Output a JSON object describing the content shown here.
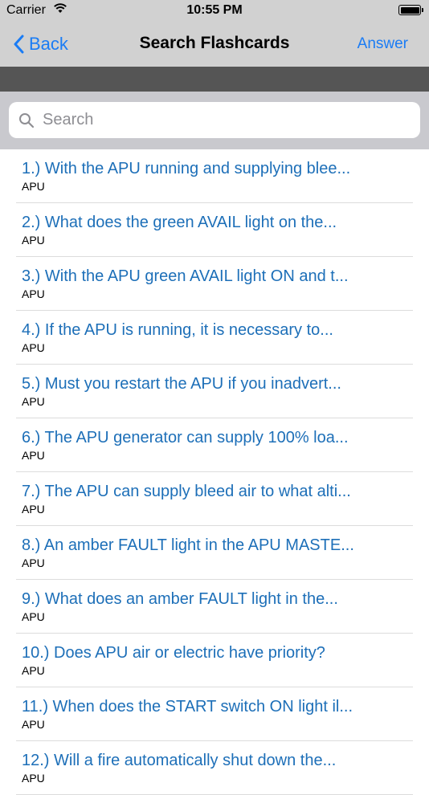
{
  "status_bar": {
    "carrier": "Carrier",
    "time": "10:55 PM"
  },
  "nav": {
    "back_label": "Back",
    "title": "Search Flashcards",
    "answer_label": "Answer"
  },
  "search": {
    "placeholder": "Search",
    "value": ""
  },
  "colors": {
    "accent": "#1a7cf5",
    "item_text": "#1d6fb8",
    "bar_bg": "#d1d1d1",
    "strip_bg": "#555555"
  },
  "items": [
    {
      "question": "1.) With the APU running and supplying blee...",
      "category": "APU"
    },
    {
      "question": "2.) What does the green AVAIL light on the...",
      "category": "APU"
    },
    {
      "question": "3.) With the APU green AVAIL light ON and t...",
      "category": "APU"
    },
    {
      "question": "4.) If the APU is running, it is necessary to...",
      "category": "APU"
    },
    {
      "question": "5.) Must you restart the APU if you inadvert...",
      "category": "APU"
    },
    {
      "question": "6.) The APU generator can supply 100% loa...",
      "category": "APU"
    },
    {
      "question": "7.) The APU can supply bleed air to what alti...",
      "category": "APU"
    },
    {
      "question": "8.) An amber FAULT light in the APU MASTE...",
      "category": "APU"
    },
    {
      "question": "9.) What does an amber FAULT light in the...",
      "category": "APU"
    },
    {
      "question": "10.) Does APU air or electric have priority?",
      "category": "APU"
    },
    {
      "question": "11.) When does the START switch ON light il...",
      "category": "APU"
    },
    {
      "question": "12.) Will a fire automatically shut down the...",
      "category": "APU"
    }
  ]
}
